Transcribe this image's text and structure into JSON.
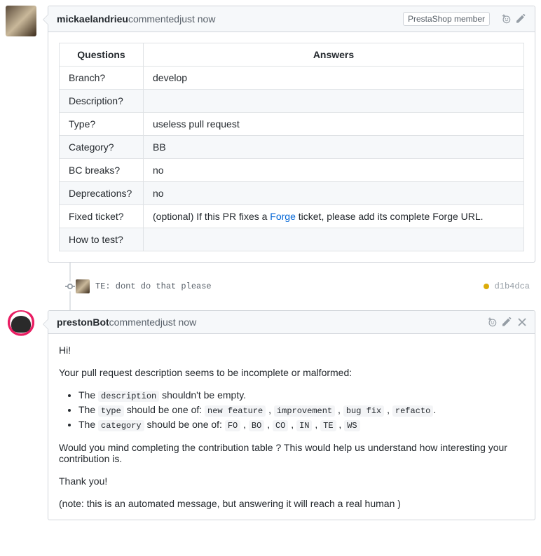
{
  "comment1": {
    "author": "mickaelandrieu",
    "commented": " commented ",
    "time": "just now",
    "badge": "PrestaShop member",
    "table": {
      "header_q": "Questions",
      "header_a": "Answers",
      "rows": [
        {
          "q": "Branch?",
          "a": "develop"
        },
        {
          "q": "Description?",
          "a": ""
        },
        {
          "q": "Type?",
          "a": "useless pull request"
        },
        {
          "q": "Category?",
          "a": "BB"
        },
        {
          "q": "BC breaks?",
          "a": "no"
        },
        {
          "q": "Deprecations?",
          "a": "no"
        },
        {
          "q": "Fixed ticket?",
          "a_pre": "(optional) If this PR fixes a ",
          "a_link": "Forge",
          "a_post": " ticket, please add its complete Forge URL."
        },
        {
          "q": "How to test?",
          "a": ""
        }
      ]
    }
  },
  "commit": {
    "message": "TE: dont do that please",
    "sha": "d1b4dca",
    "status": "pending"
  },
  "comment2": {
    "author": "prestonBot",
    "commented": " commented ",
    "time": "just now",
    "greeting": "Hi!",
    "intro": "Your pull request description seems to be incomplete or malformed:",
    "bullets": {
      "b1_pre": "The ",
      "b1_code": "description",
      "b1_post": " shouldn't be empty.",
      "b2_pre": "The ",
      "b2_code": "type",
      "b2_mid": " should be one of: ",
      "b2_opts": [
        "new feature",
        "improvement",
        "bug fix",
        "refacto"
      ],
      "b2_end": ".",
      "b3_pre": "The ",
      "b3_code": "category",
      "b3_mid": " should be one of: ",
      "b3_opts": [
        "FO",
        "BO",
        "CO",
        "IN",
        "TE",
        "WS"
      ]
    },
    "ask": "Would you mind completing the contribution table ? This would help us understand how interesting your contribution is.",
    "thanks": "Thank you!",
    "note": "(note: this is an automated message, but answering it will reach a real human )"
  },
  "sep": " , "
}
